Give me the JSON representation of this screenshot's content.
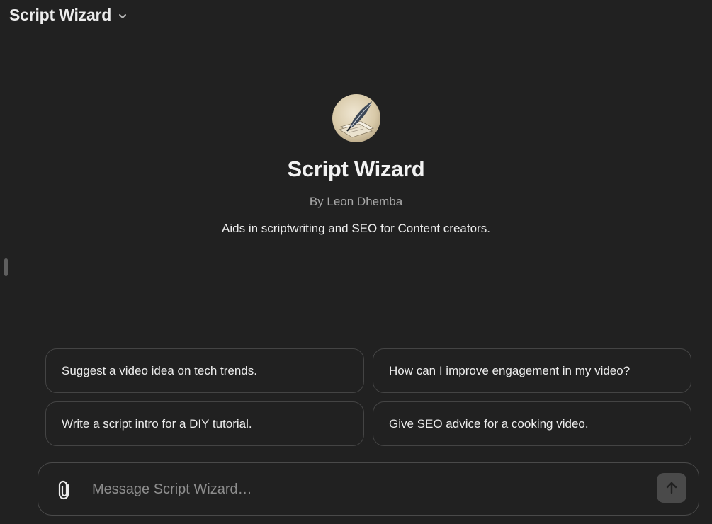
{
  "header": {
    "title": "Script Wizard",
    "dropdown_icon": "chevron-down-icon"
  },
  "gpt": {
    "avatar_icon": "quill-pen-avatar",
    "name": "Script Wizard",
    "author": "By Leon Dhemba",
    "description": "Aids in scriptwriting and SEO for Content creators."
  },
  "suggestions": [
    "Suggest a video idea on tech trends.",
    "How can I improve engagement in my video?",
    "Write a script intro for a DIY tutorial.",
    "Give SEO advice for a cooking video."
  ],
  "composer": {
    "placeholder": "Message Script Wizard…",
    "value": "",
    "attach_icon": "paperclip-icon",
    "send_icon": "arrow-up-icon"
  },
  "colors": {
    "background": "#212121",
    "text": "#ececec",
    "muted": "#a8a8a8",
    "border": "#444444",
    "send_button": "#4a4a4a"
  }
}
